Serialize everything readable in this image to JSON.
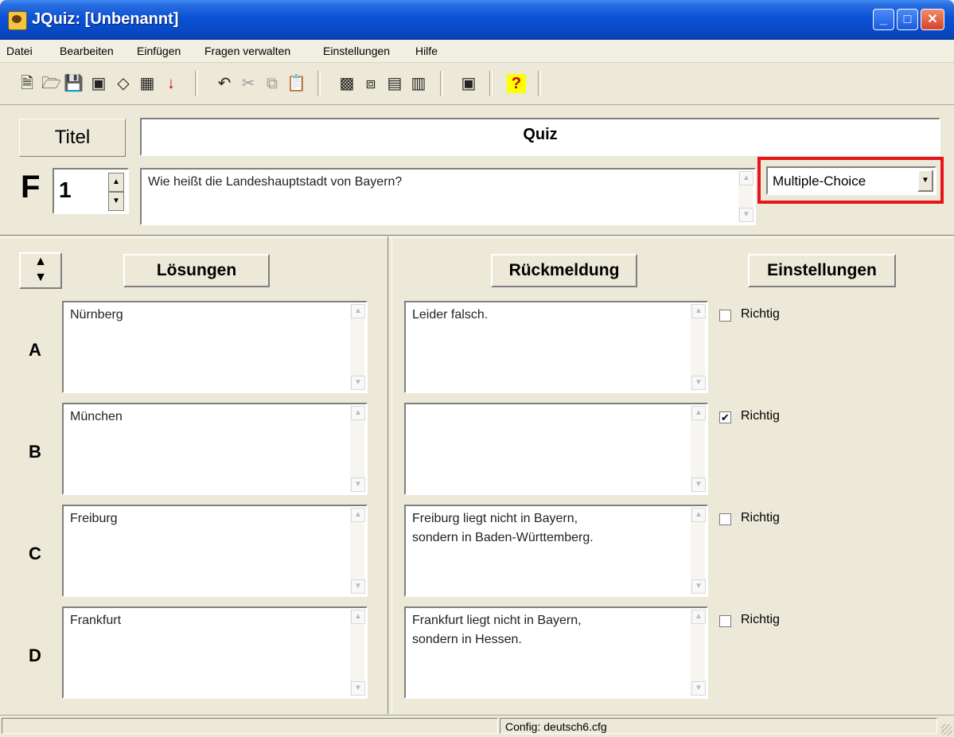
{
  "window": {
    "title": "JQuiz: [Unbenannt]"
  },
  "menu": [
    "Datei",
    "Bearbeiten",
    "Einfügen",
    "Fragen verwalten",
    "Einstellungen",
    "Hilfe"
  ],
  "toolbar": {
    "icons": [
      "new-file-icon",
      "open-folder-icon",
      "save-icon",
      "save-as-icon",
      "eraser-icon",
      "html-export-icon",
      "export-arrow-icon",
      "undo-icon",
      "cut-icon",
      "copy-icon",
      "paste-icon",
      "image-icon",
      "link-icon",
      "keyboard-icon",
      "translate-icon",
      "monitor-icon",
      "help-icon"
    ]
  },
  "title_label": "Titel",
  "title_value": "Quiz",
  "question_label": "F",
  "question_number": "1",
  "question_text": "Wie heißt die Landeshauptstadt von Bayern?",
  "question_type": "Multiple-Choice",
  "headers": {
    "answers": "Lösungen",
    "feedback": "Rückmeldung",
    "settings": "Einstellungen"
  },
  "rows": [
    {
      "letter": "A",
      "answer": "Nürnberg",
      "feedback": "Leider falsch.",
      "correct_label": "Richtig",
      "correct": false
    },
    {
      "letter": "B",
      "answer": "München",
      "feedback": "",
      "correct_label": "Richtig",
      "correct": true
    },
    {
      "letter": "C",
      "answer": "Freiburg",
      "feedback": "Freiburg liegt nicht in Bayern,\nsondern in Baden-Württemberg.",
      "correct_label": "Richtig",
      "correct": false
    },
    {
      "letter": "D",
      "answer": "Frankfurt",
      "feedback": "Frankfurt liegt nicht in Bayern,\nsondern in Hessen.",
      "correct_label": "Richtig",
      "correct": false
    }
  ],
  "status": {
    "config": "Config: deutsch6.cfg"
  },
  "colors": {
    "titlebar": "#0a52d6",
    "highlight": "#e8141c"
  }
}
